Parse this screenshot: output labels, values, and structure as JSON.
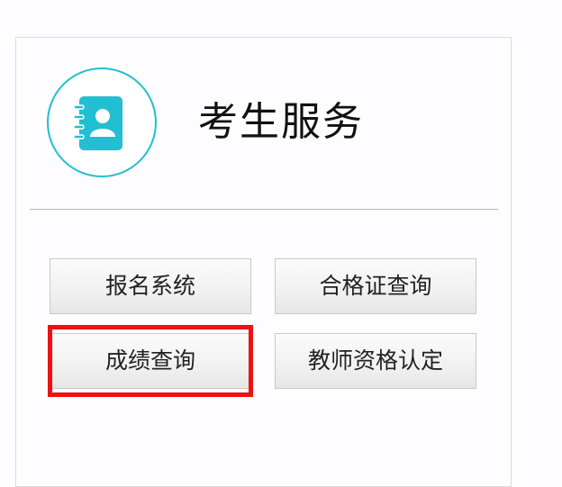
{
  "service": {
    "title": "考生服务",
    "icon": "contact-book-icon",
    "accent_color": "#21bfd1"
  },
  "buttons": [
    {
      "label": "报名系统"
    },
    {
      "label": "合格证查询"
    },
    {
      "label": "成绩查询",
      "highlighted": true
    },
    {
      "label": "教师资格认定"
    }
  ],
  "highlight_color": "#ee1111"
}
